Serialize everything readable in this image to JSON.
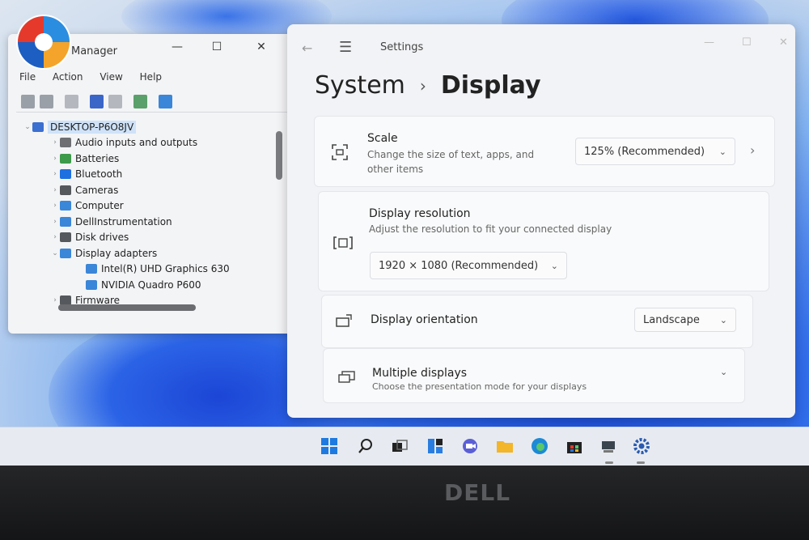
{
  "device_manager": {
    "title": "Manager",
    "menu": [
      "File",
      "Action",
      "View",
      "Help"
    ],
    "tree": [
      {
        "label": "DESKTOP-P6O8JV",
        "level": 0,
        "expanded": true,
        "selected": true,
        "icon": "computer-icon",
        "color": "#3b6fd0"
      },
      {
        "label": "Audio inputs and outputs",
        "level": 1,
        "expanded": false,
        "icon": "speaker-icon",
        "color": "#6d6f73"
      },
      {
        "label": "Batteries",
        "level": 1,
        "expanded": false,
        "icon": "battery-icon",
        "color": "#3c9a4a"
      },
      {
        "label": "Bluetooth",
        "level": 1,
        "expanded": false,
        "icon": "bluetooth-icon",
        "color": "#1e6fe0"
      },
      {
        "label": "Cameras",
        "level": 1,
        "expanded": false,
        "icon": "camera-icon",
        "color": "#55585c"
      },
      {
        "label": "Computer",
        "level": 1,
        "expanded": false,
        "icon": "monitor-icon",
        "color": "#3a86d8"
      },
      {
        "label": "DellInstrumentation",
        "level": 1,
        "expanded": false,
        "icon": "monitor-icon",
        "color": "#3a86d8"
      },
      {
        "label": "Disk drives",
        "level": 1,
        "expanded": false,
        "icon": "disk-icon",
        "color": "#55585c"
      },
      {
        "label": "Display adapters",
        "level": 1,
        "expanded": true,
        "icon": "display-adapter-icon",
        "color": "#3a86d8"
      },
      {
        "label": "Intel(R) UHD Graphics 630",
        "level": 2,
        "icon": "display-adapter-icon",
        "color": "#3a86d8"
      },
      {
        "label": "NVIDIA Quadro P600",
        "level": 2,
        "icon": "display-adapter-icon",
        "color": "#3a86d8"
      },
      {
        "label": "Firmware",
        "level": 1,
        "expanded": false,
        "icon": "chip-icon",
        "color": "#55585c"
      }
    ]
  },
  "settings": {
    "window_title": "Settings",
    "breadcrumb": {
      "parent": "System",
      "current": "Display"
    },
    "scale": {
      "title": "Scale",
      "desc": "Change the size of text, apps, and other items",
      "value": "125% (Recommended)",
      "icon": "scale-icon"
    },
    "resolution": {
      "title": "Display resolution",
      "desc": "Adjust the resolution to fit your connected display",
      "value": "1920 × 1080 (Recommended)",
      "icon": "resolution-icon"
    },
    "orientation": {
      "title": "Display orientation",
      "value": "Landscape",
      "icon": "orientation-icon"
    },
    "multiple": {
      "title": "Multiple displays",
      "desc": "Choose the presentation mode for your displays",
      "icon": "multiple-displays-icon"
    }
  },
  "taskbar": {
    "icons": [
      "windows-start-icon",
      "search-icon",
      "task-view-icon",
      "widgets-icon",
      "chat-icon",
      "file-explorer-icon",
      "edge-icon",
      "store-icon",
      "device-manager-icon",
      "settings-icon"
    ]
  },
  "bezel": {
    "brand": "DELL"
  }
}
